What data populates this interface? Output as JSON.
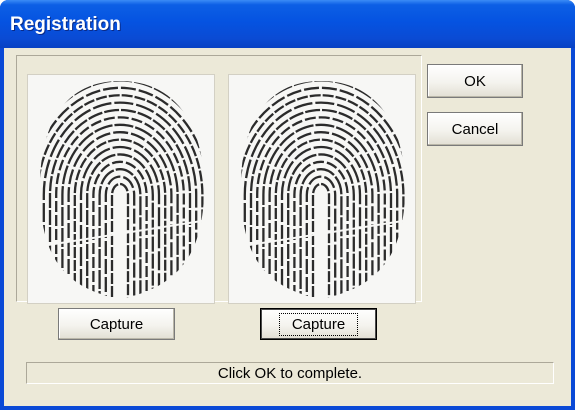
{
  "window": {
    "title": "Registration"
  },
  "buttons": {
    "ok_label": "OK",
    "cancel_label": "Cancel",
    "capture_left_label": "Capture",
    "capture_right_label": "Capture"
  },
  "status": {
    "text": "Click OK to complete."
  },
  "icons": {
    "fingerprint_left": "fingerprint-image",
    "fingerprint_right": "fingerprint-image"
  },
  "colors": {
    "titlebar": "#0553e1",
    "dialog_bg": "#ece9d8"
  }
}
